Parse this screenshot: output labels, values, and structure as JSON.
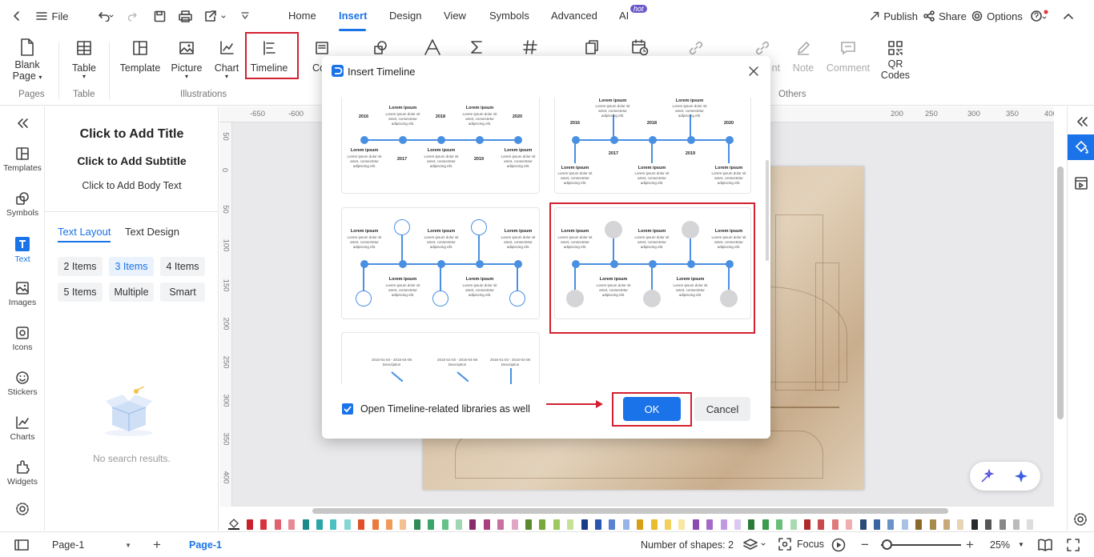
{
  "topbar": {
    "file_label": "File",
    "menu": [
      "Home",
      "Insert",
      "Design",
      "View",
      "Symbols",
      "Advanced",
      "AI"
    ],
    "ai_badge": "hot",
    "publish": "Publish",
    "share": "Share",
    "options": "Options"
  },
  "ribbon": {
    "blank_page": [
      "Blank",
      "Page"
    ],
    "table": "Table",
    "template": "Template",
    "picture": "Picture",
    "chart": "Chart",
    "timeline": "Timeline",
    "container_partial": "Co",
    "link_partial": "nt",
    "note": "Note",
    "comment": "Comment",
    "qr": [
      "QR",
      "Codes"
    ],
    "groups": {
      "pages": "Pages",
      "table": "Table",
      "illustrations": "Illustrations",
      "others": "Others"
    }
  },
  "rail": [
    {
      "label": "Templates",
      "icon": "templates-icon"
    },
    {
      "label": "Symbols",
      "icon": "symbols-icon"
    },
    {
      "label": "Text",
      "icon": "text-icon"
    },
    {
      "label": "Images",
      "icon": "images-icon"
    },
    {
      "label": "Icons",
      "icon": "icons-icon"
    },
    {
      "label": "Stickers",
      "icon": "stickers-icon"
    },
    {
      "label": "Charts",
      "icon": "charts-icon"
    },
    {
      "label": "Widgets",
      "icon": "widgets-icon"
    }
  ],
  "panel": {
    "title": "Click to Add Title",
    "subtitle": "Click to Add Subtitle",
    "body": "Click to Add Body Text",
    "tab_layout": "Text Layout",
    "tab_design": "Text Design",
    "buttons": [
      "2 Items",
      "3 Items",
      "4 Items",
      "5 Items",
      "Multiple",
      "Smart"
    ],
    "empty": "No search results."
  },
  "ruler": {
    "h": [
      "-650",
      "-600",
      "200",
      "250",
      "300",
      "350",
      "400"
    ],
    "v": [
      "50",
      "0",
      "50",
      "100",
      "150",
      "200",
      "250",
      "300",
      "350",
      "400"
    ]
  },
  "dialog": {
    "title": "Insert Timeline",
    "checkbox_label": "Open Timeline-related libraries as well",
    "ok": "OK",
    "cancel": "Cancel",
    "lorem": "Lorem ipsum",
    "lorem_small": "Lorem ipsum dolor sit amet, consectetur adipiscing elit.",
    "years_a": [
      "2016",
      "2017",
      "2018",
      "2019",
      "2020"
    ],
    "date_range": "2016-01-03 - 2016-04-08",
    "description": "Description"
  },
  "status": {
    "page_select": "Page-1",
    "page_tab": "Page-1",
    "shapes": "Number of shapes: 2",
    "focus": "Focus",
    "zoom": "25%"
  },
  "palette": [
    "#c8202c",
    "#d8323e",
    "#e0606e",
    "#e88a96",
    "#1a8a8a",
    "#2aa5a5",
    "#4cc0c0",
    "#86d6d6",
    "#e0502a",
    "#ea7a3a",
    "#f09a5a",
    "#f5bf8f",
    "#2e8b57",
    "#3aa56a",
    "#66c08a",
    "#9fd8b2",
    "#8a2a6a",
    "#a8407e",
    "#c870a0",
    "#e0a6c6",
    "#5a8a2a",
    "#76a83a",
    "#9cc860",
    "#c6e29a",
    "#1a3a8a",
    "#2a56b0",
    "#5a82d0",
    "#98b4e6",
    "#d8a01a",
    "#e8bc2a",
    "#f2d060",
    "#f8e6a2",
    "#8a4ab0",
    "#a468c8",
    "#c09ae0",
    "#dcc8f0",
    "#2a7a3a",
    "#3a9a4e",
    "#6abe7a",
    "#a6dcb0",
    "#b02a2a",
    "#c84a4a",
    "#e07a7a",
    "#f0b0b0",
    "#2a4a7a",
    "#3a66a0",
    "#6a92c8",
    "#a8c2e6",
    "#8a6a2a",
    "#a88a4a",
    "#c8aa7a",
    "#e6d4b4",
    "#2a2a2a",
    "#555555",
    "#888888",
    "#bbbbbb",
    "#dddddd"
  ]
}
